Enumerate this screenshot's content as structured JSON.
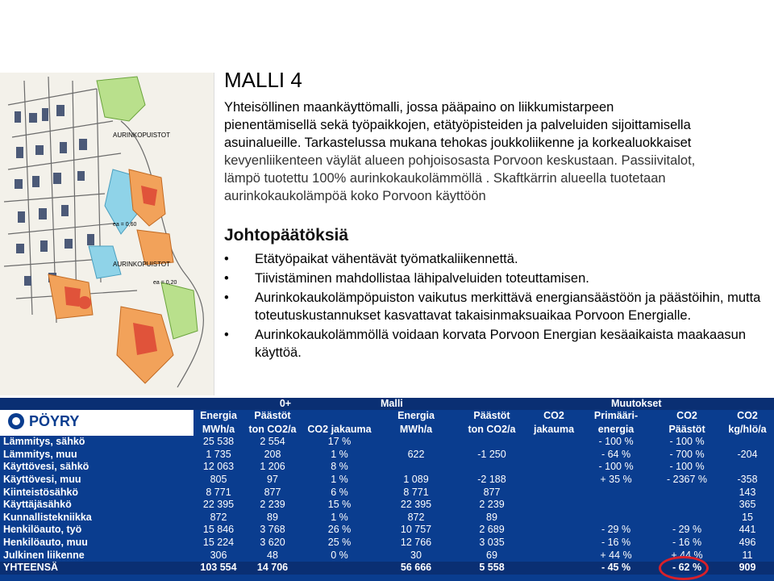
{
  "slide": {
    "title": "MALLI 4",
    "intro_line1": "Yhteisöllinen maankäyttömalli, jossa pääpaino on liikkumistarpeen",
    "intro_line2": "pienentämisellä sekä työpaikkojen, etätyöpisteiden ja palveluiden sijoittamisella",
    "intro_line3": "asuinalueille. Tarkastelussa mukana tehokas joukkoliikenne ja korkealuokkaiset",
    "intro_line4": "kevyenliikenteen väylät alueen pohjoisosasta Porvoon keskustaan.  Passiivitalot,",
    "intro_line5": "lämpö tuotettu 100% aurinkokaukolämmöllä . Skaftkärrin alueella tuotetaan",
    "intro_line6": "aurinkokaukolämpöä koko Porvoon käyttöön",
    "subheading": "Johtopäätöksiä",
    "bullet_glyph": "•",
    "bullets": [
      "Etätyöpaikat vähentävät työmatkaliikennettä.",
      "Tiivistäminen mahdollistaa lähipalveluiden toteuttamisen.",
      "Aurinkokaukolämpöpuiston vaikutus merkittävä energiansäästöön ja päästöihin, mutta toteutuskustannukset kasvattavat takaisinmaksuaikaa Porvoon Energialle.",
      "Aurinkokaukolämmöllä voidaan korvata Porvoon Energian kesäaikaista maakaasun käyttöä."
    ]
  },
  "map": {
    "labels": [
      "AURINKOPUISTOT",
      "AURINKOPUISTOT",
      "ea = 0,20",
      "ea = 0,60"
    ],
    "colors": {
      "residential": "#f2a25a",
      "dense": "#e0533a",
      "green": "#b9e08c",
      "water": "#8fd3e8",
      "roads": "#555555"
    }
  },
  "logo": {
    "text": "PÖYRY"
  },
  "table": {
    "group_headers": {
      "g1": "0+",
      "g2": "Malli",
      "g3": "Muutokset"
    },
    "headers_line1": [
      "Energia",
      "Päästöt",
      "",
      "Energia",
      "Päästöt",
      "CO2",
      "Primääri-",
      "CO2",
      "CO2"
    ],
    "headers_line2": [
      "MWh/a",
      "ton CO2/a",
      "CO2 jakauma",
      "MWh/a",
      "ton CO2/a",
      "jakauma",
      "energia",
      "Päästöt",
      "kg/hlö/a"
    ],
    "rows": [
      {
        "label": "Lämmitys, sähkö",
        "v": [
          "25 538",
          "2 554",
          "17 %",
          "",
          "",
          "",
          "- 100 %",
          "- 100 %",
          ""
        ]
      },
      {
        "label": "Lämmitys, muu",
        "v": [
          "1 735",
          "208",
          "1 %",
          "622",
          "-1 250",
          "",
          "- 64 %",
          "- 700 %",
          "-204"
        ]
      },
      {
        "label": "Käyttövesi, sähkö",
        "v": [
          "12 063",
          "1 206",
          "8 %",
          "",
          "",
          "",
          "- 100 %",
          "- 100 %",
          ""
        ]
      },
      {
        "label": "Käyttövesi, muu",
        "v": [
          "805",
          "97",
          "1 %",
          "1 089",
          "-2 188",
          "",
          "+ 35 %",
          "- 2367 %",
          "-358"
        ]
      },
      {
        "label": "Kiinteistösähkö",
        "v": [
          "8 771",
          "877",
          "6 %",
          "8 771",
          "877",
          "",
          "",
          "",
          "143"
        ]
      },
      {
        "label": "Käyttäjäsähkö",
        "v": [
          "22 395",
          "2 239",
          "15 %",
          "22 395",
          "2 239",
          "",
          "",
          "",
          "365"
        ]
      },
      {
        "label": "Kunnallistekniikka",
        "v": [
          "872",
          "89",
          "1 %",
          "872",
          "89",
          "",
          "",
          "",
          "15"
        ]
      },
      {
        "label": "Henkilöauto, työ",
        "v": [
          "15 846",
          "3 768",
          "26 %",
          "10 757",
          "2 689",
          "",
          "- 29 %",
          "- 29 %",
          "441"
        ]
      },
      {
        "label": "Henkilöauto, muu",
        "v": [
          "15 224",
          "3 620",
          "25 %",
          "12 766",
          "3 035",
          "",
          "- 16 %",
          "- 16 %",
          "496"
        ]
      },
      {
        "label": "Julkinen liikenne",
        "v": [
          "306",
          "48",
          "0 %",
          "30",
          "69",
          "",
          "+ 44 %",
          "+ 44 %",
          "11"
        ]
      }
    ],
    "total": {
      "label": "YHTEENSÄ",
      "v": [
        "103 554",
        "14 706",
        "",
        "56 666",
        "5 558",
        "",
        "- 45 %",
        "- 62 %",
        "909"
      ]
    },
    "highlight_color": "#d8202a"
  }
}
